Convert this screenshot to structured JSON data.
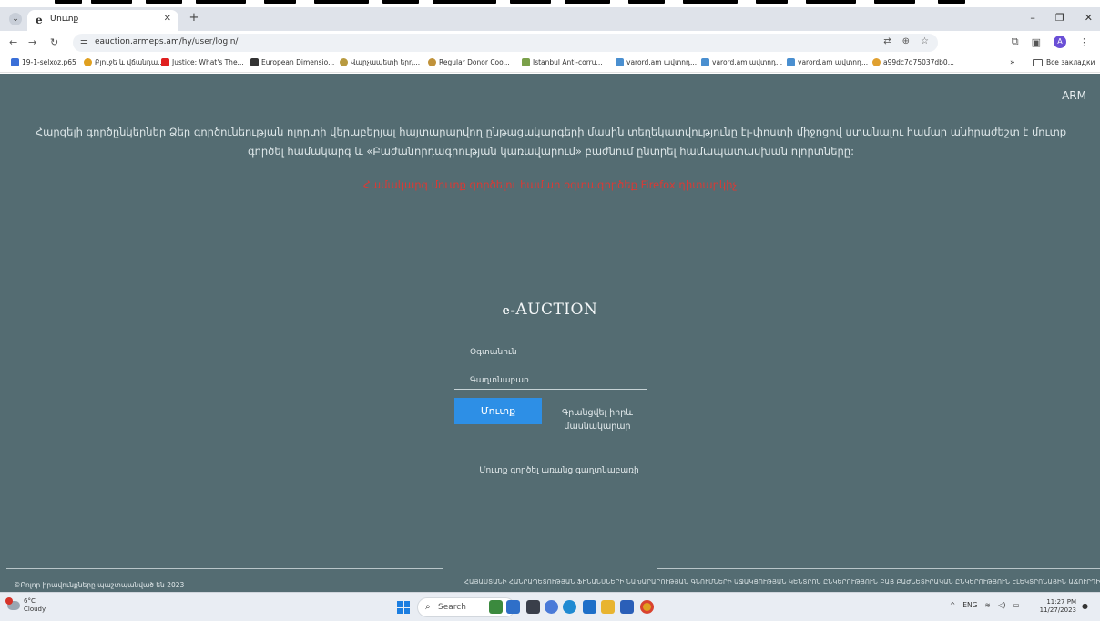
{
  "browser": {
    "tab_title": "Մուտք",
    "url": "eauction.armeps.am/hy/user/login/",
    "bookmarks": [
      "19-1-selxoz.p65",
      "Բյուջե և վճանդա...",
      "Justice: What's The...",
      "European Dimensio...",
      "Վարչապետի երդ...",
      "Regular Donor Coo...",
      "Istanbul Anti-corru...",
      "varord.am ավտոդ...",
      "varord.am ավտոդ...",
      "varord.am ավտոդ...",
      "a99dc7d75037db0..."
    ],
    "more_bookmarks": "»",
    "all_bookmarks": "Все закладки"
  },
  "page": {
    "lang": "ARM",
    "notice": "Հարգելի գործընկերներ Ձեր գործունեության ոլորտի վերաբերյալ հայտարարվող ընթացակարգերի մասին տեղեկատվությունը էլ-փոստի միջոցով ստանալու համար անհրաժեշտ է մուտք գործել համակարգ և «Բաժանորդագրության կառավարում» բաժնում ընտրել համապատասխան ոլորտները:",
    "firefox_warning": "Համակարգ մուտք գործելու համար օգտագործեք Firefox դիտարկիչ",
    "brand_prefix": "e-",
    "brand_name": "AUCTION",
    "username_placeholder": "Օգտանուն",
    "password_placeholder": "Գաղտնաբառ",
    "login_button": "Մուտք",
    "register_link": "Գրանցվել իրրև մասնակարար",
    "guest_link": "Մուտք գործել առանց գաղտնաբառի",
    "copyright": "©Բոլոր իրավունքները պաշտպանված են 2023",
    "footer_text": "ՀԱՅԱՍՏԱՆԻ ՀԱՆՐԱՊԵՏՈՒԹՅԱՆ ՖԻՆԱՆՍՆԵՐԻ ՆԱԽԱՐԱՐՈՒԹՅԱՆ ԳՆՈՒՄՆԵՐԻ ԱՋԱԿՑՈՒԹՅԱՆ ԿԵՆՏՐՈՆ ԸՆԿԵՐՈՒԹՅՈՒՆ ԲԱՑ ԲԱԺՆԵՏԻՐԱԿԱՆ ԸՆԿԵՐՈՒԹՅՈՒՆ ԷԼԵԿՏՐՈՆԱՅԻՆ ԱՃՈՒՐԴԻ ՀԱՄԱԿԱՐԳ"
  },
  "taskbar": {
    "temp": "6°C",
    "weather": "Cloudy",
    "search": "Search",
    "lang": "ENG",
    "time": "11:27 PM",
    "date": "11/27/2023"
  }
}
